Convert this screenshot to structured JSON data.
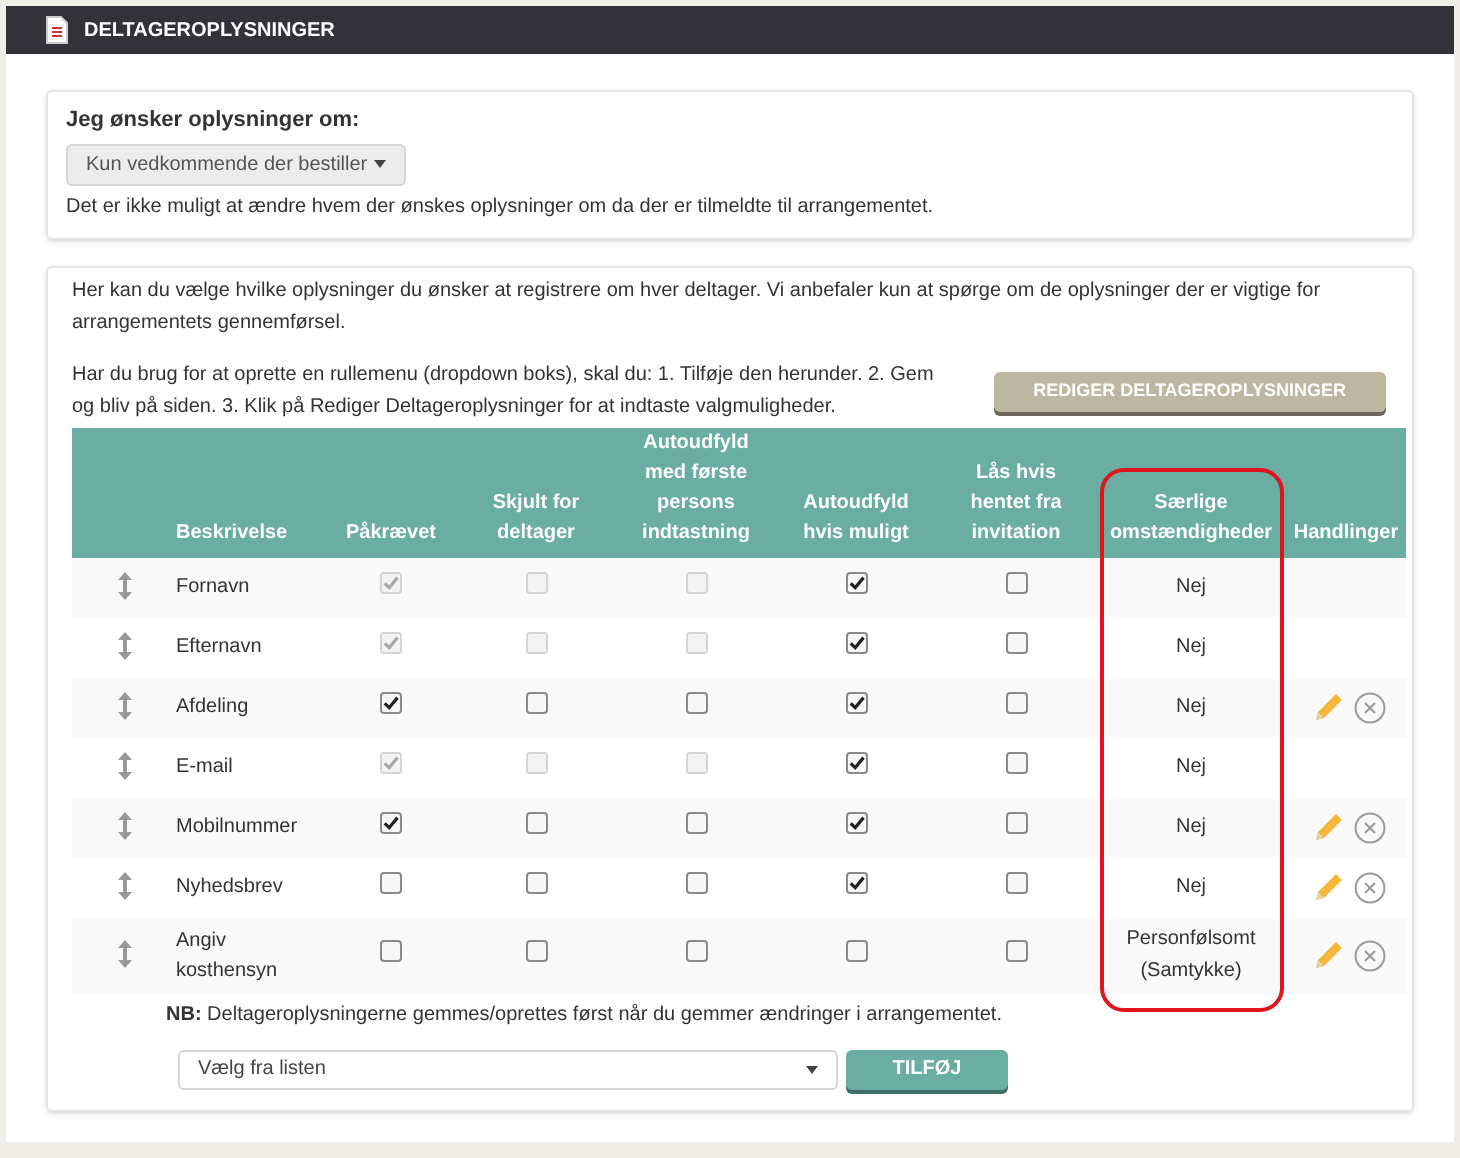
{
  "header": {
    "title": "DELTAGEROPLYSNINGER"
  },
  "info_panel": {
    "label": "Jeg ønsker oplysninger om:",
    "select_value": "Kun vedkommende der bestiller",
    "note": "Det er ikke muligt at ændre hvem der ønskes oplysninger om da der er tilmeldte til arrangementet."
  },
  "fields_panel": {
    "intro": "Her kan du vælge hvilke oplysninger du ønsker at registrere om hver deltager. Vi anbefaler kun at spørge om de oplysninger der er vigtige for arrangementets gennemførsel.",
    "help": "Har du brug for at oprette en rullemenu (dropdown boks), skal du: 1. Tilføje den herunder. 2. Gem og bliv på siden. 3. Klik på Rediger Deltageroplysninger for at indtaste valgmuligheder.",
    "edit_button": "REDIGER DELTAGEROPLYSNINGER",
    "columns": [
      {
        "label": "Beskrivelse",
        "highlighted": false
      },
      {
        "label": "Påkrævet",
        "highlighted": false
      },
      {
        "label": "Skjult for deltager",
        "highlighted": false
      },
      {
        "label": "Autoudfyld med første persons indtastning",
        "highlighted": false
      },
      {
        "label": "Autoudfyld hvis muligt",
        "highlighted": false
      },
      {
        "label": "Lås hvis hentet fra invitation",
        "highlighted": false
      },
      {
        "label": "Særlige omstændigheder",
        "highlighted": true
      },
      {
        "label": "Handlinger",
        "highlighted": false
      }
    ],
    "rows": [
      {
        "name": "Fornavn",
        "checks": [
          {
            "checked": true,
            "disabled": true
          },
          {
            "checked": false,
            "disabled": true
          },
          {
            "checked": false,
            "disabled": true
          },
          {
            "checked": true,
            "disabled": false
          },
          {
            "checked": false,
            "disabled": false
          }
        ],
        "special": "Nej",
        "actions": false
      },
      {
        "name": "Efternavn",
        "checks": [
          {
            "checked": true,
            "disabled": true
          },
          {
            "checked": false,
            "disabled": true
          },
          {
            "checked": false,
            "disabled": true
          },
          {
            "checked": true,
            "disabled": false
          },
          {
            "checked": false,
            "disabled": false
          }
        ],
        "special": "Nej",
        "actions": false
      },
      {
        "name": "Afdeling",
        "checks": [
          {
            "checked": true,
            "disabled": false
          },
          {
            "checked": false,
            "disabled": false
          },
          {
            "checked": false,
            "disabled": false
          },
          {
            "checked": true,
            "disabled": false
          },
          {
            "checked": false,
            "disabled": false
          }
        ],
        "special": "Nej",
        "actions": true
      },
      {
        "name": "E-mail",
        "checks": [
          {
            "checked": true,
            "disabled": true
          },
          {
            "checked": false,
            "disabled": true
          },
          {
            "checked": false,
            "disabled": true
          },
          {
            "checked": true,
            "disabled": false
          },
          {
            "checked": false,
            "disabled": false
          }
        ],
        "special": "Nej",
        "actions": false
      },
      {
        "name": "Mobilnummer",
        "checks": [
          {
            "checked": true,
            "disabled": false
          },
          {
            "checked": false,
            "disabled": false
          },
          {
            "checked": false,
            "disabled": false
          },
          {
            "checked": true,
            "disabled": false
          },
          {
            "checked": false,
            "disabled": false
          }
        ],
        "special": "Nej",
        "actions": true
      },
      {
        "name": "Nyhedsbrev",
        "checks": [
          {
            "checked": false,
            "disabled": false
          },
          {
            "checked": false,
            "disabled": false
          },
          {
            "checked": false,
            "disabled": false
          },
          {
            "checked": true,
            "disabled": false
          },
          {
            "checked": false,
            "disabled": false
          }
        ],
        "special": "Nej",
        "actions": true
      },
      {
        "name": "Angiv kosthensyn",
        "checks": [
          {
            "checked": false,
            "disabled": false
          },
          {
            "checked": false,
            "disabled": false
          },
          {
            "checked": false,
            "disabled": false
          },
          {
            "checked": false,
            "disabled": false
          },
          {
            "checked": false,
            "disabled": false
          }
        ],
        "special": "Personfølsomt (Samtykke)",
        "actions": true
      }
    ],
    "footnote": "**NB:** Deltageroplysningerne gemmes/oprettes først når du gemmer ændringer i arrangementet.",
    "add_select": "Vælg fra listen",
    "add_button": "TILFØJ"
  }
}
